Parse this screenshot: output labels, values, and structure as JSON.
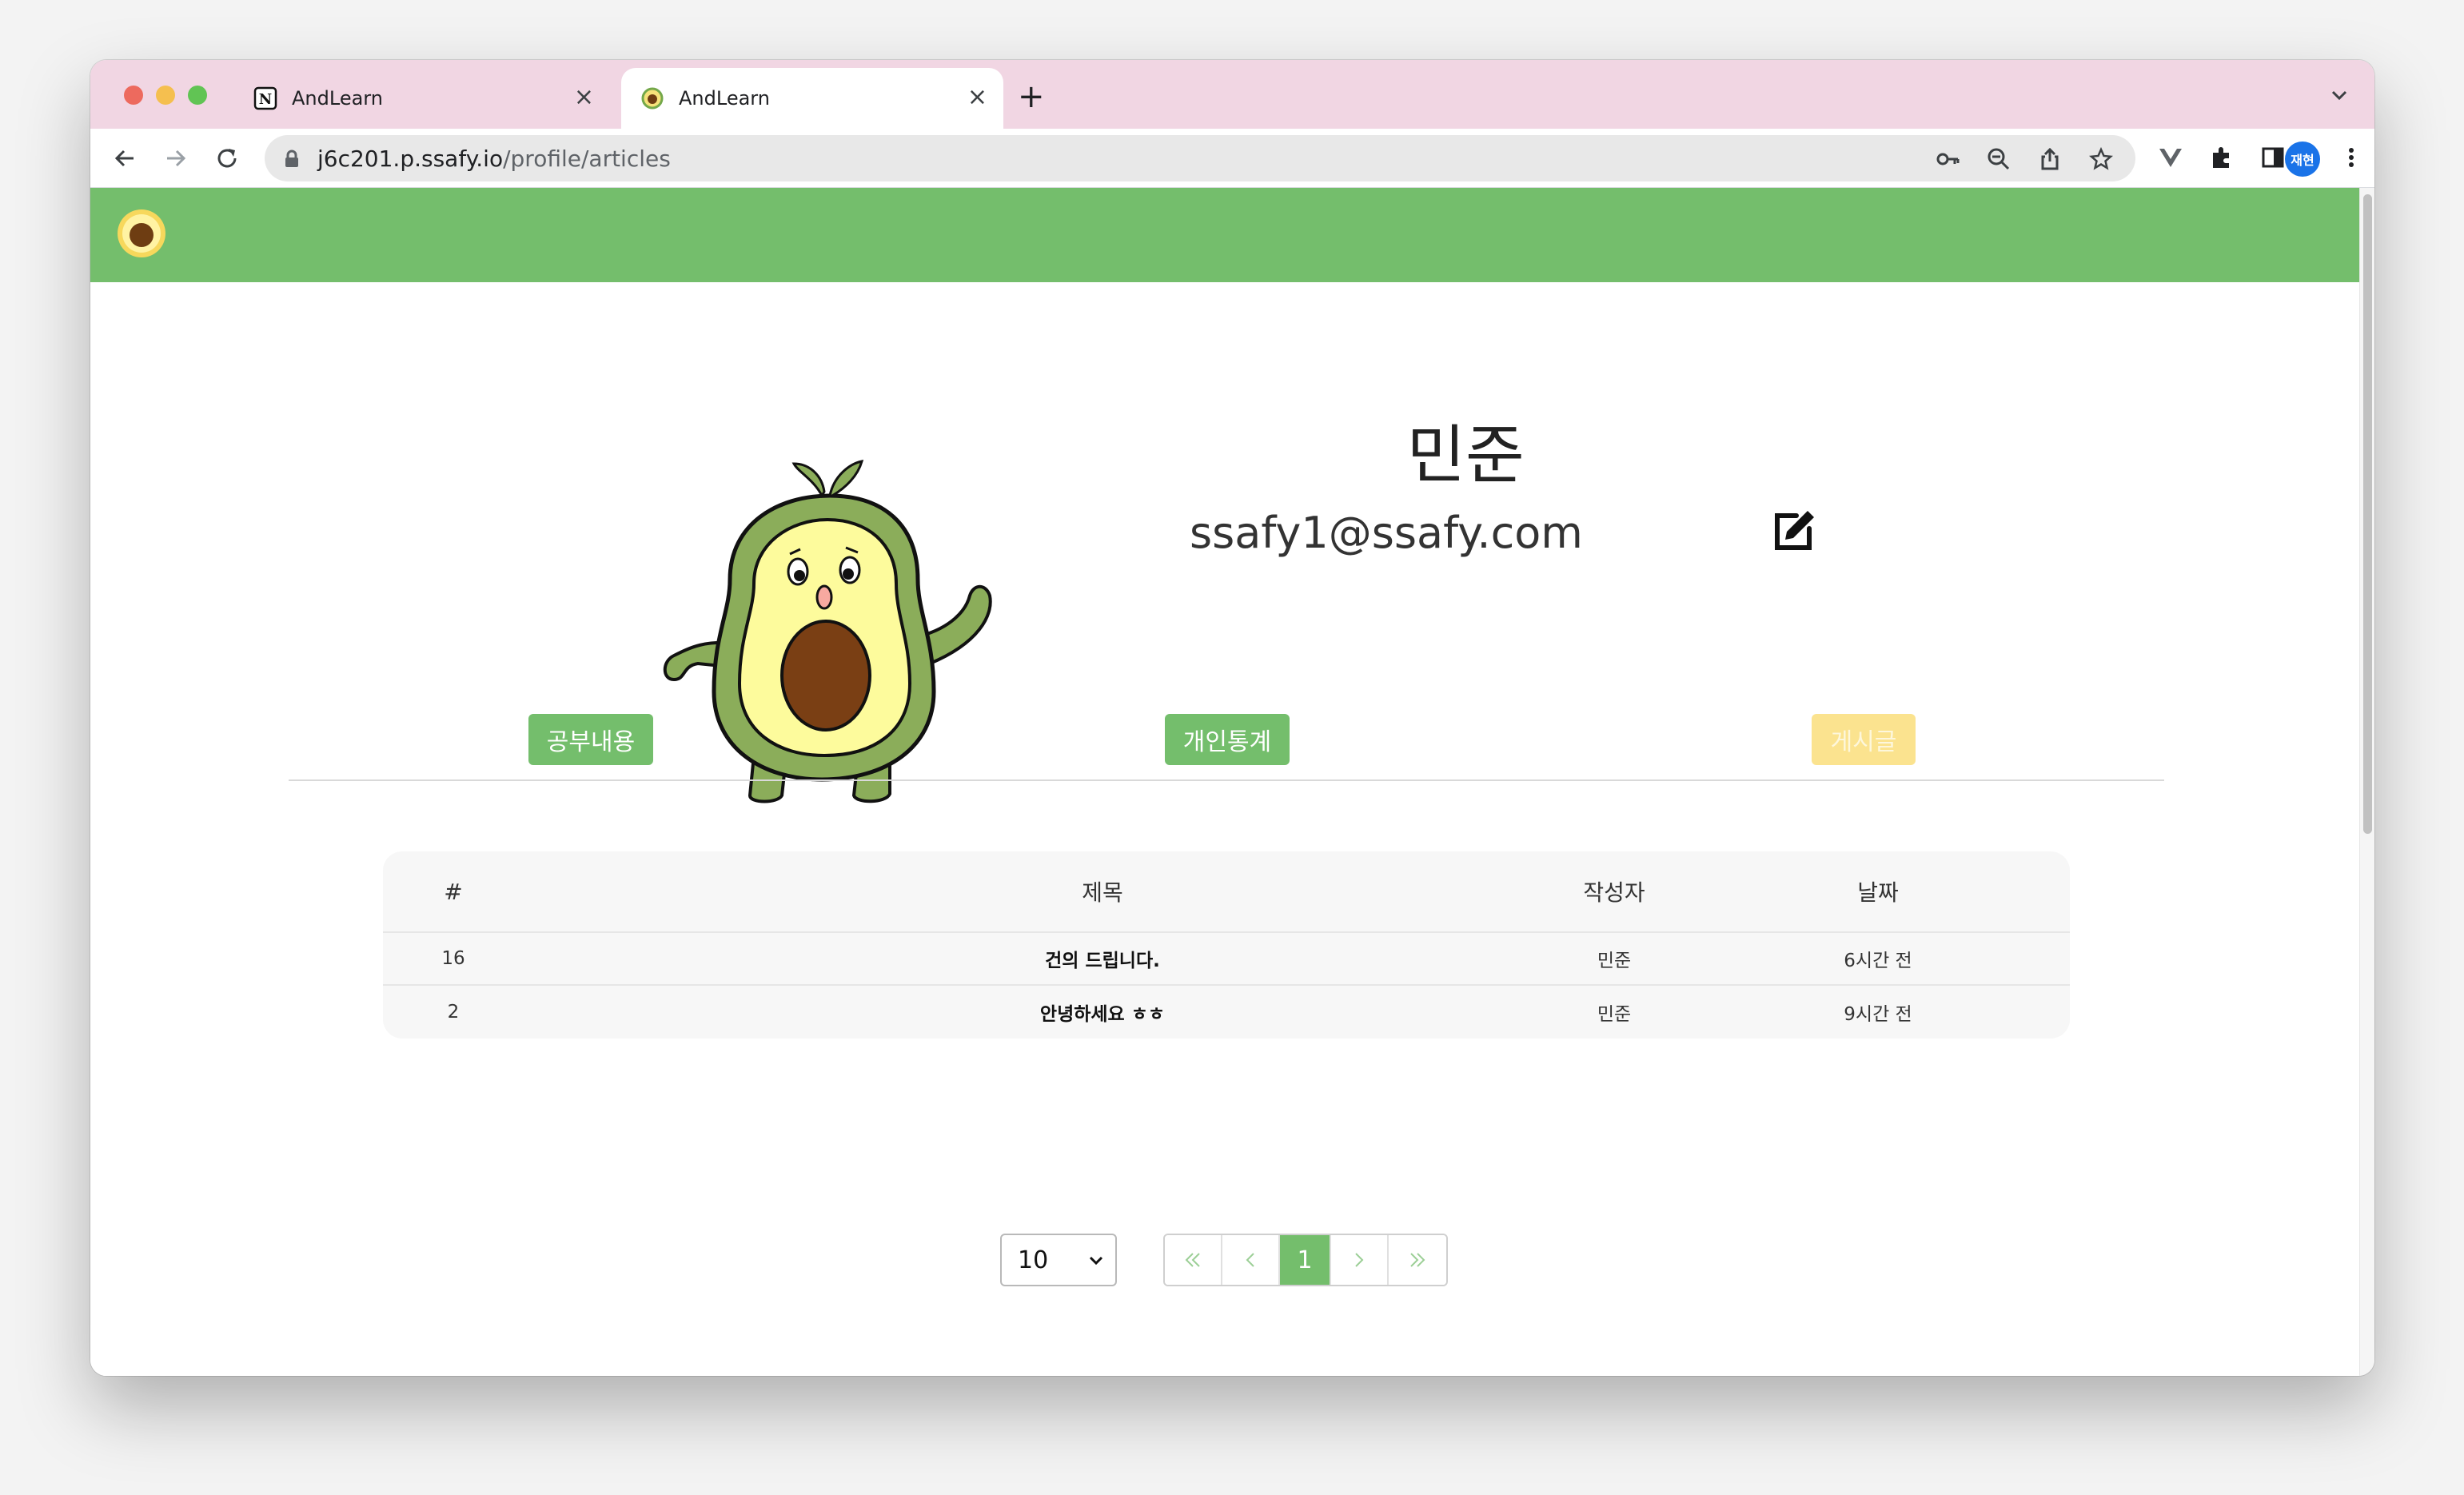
{
  "browser": {
    "tabs": [
      {
        "title": "AndLearn",
        "favicon": "notion-icon"
      },
      {
        "title": "AndLearn",
        "favicon": "avocado-icon"
      }
    ],
    "url_host": "j6c201.p.ssafy.io",
    "url_path": "/profile/articles",
    "profile_label": "재현"
  },
  "profile": {
    "name": "민준",
    "email": "ssafy1@ssafy.com"
  },
  "nav_buttons": {
    "study": "공부내용",
    "stats": "개인통계",
    "articles": "게시글"
  },
  "table": {
    "headers": {
      "num": "#",
      "title": "제목",
      "author": "작성자",
      "date": "날짜"
    },
    "rows": [
      {
        "num": "16",
        "title": "건의 드립니다.",
        "author": "민준",
        "date": "6시간 전"
      },
      {
        "num": "2",
        "title": "안녕하세요 ㅎㅎ",
        "author": "민준",
        "date": "9시간 전"
      }
    ]
  },
  "pagination": {
    "page_size": "10",
    "current_page": "1"
  },
  "colors": {
    "header_green": "#74be6c",
    "active_tab_yellow": "#fbe38f",
    "tab_strip_pink": "#f1d6e3"
  }
}
